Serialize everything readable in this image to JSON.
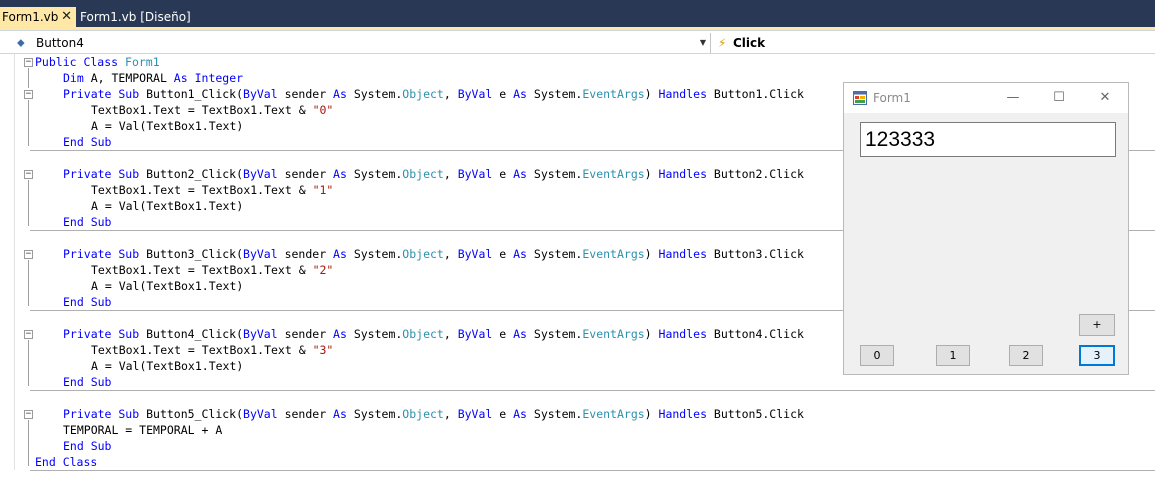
{
  "tabs": [
    {
      "label": "Form1.vb",
      "close": "✕"
    },
    {
      "label": "Form1.vb [Diseño]"
    }
  ],
  "navbar": {
    "object": "Button4",
    "event": "Click"
  },
  "code": {
    "l1": [
      "Public Class ",
      "Form1"
    ],
    "l2": [
      "Dim",
      " A, TEMPORAL ",
      "As",
      " ",
      "Integer"
    ],
    "b1": [
      "Private Sub",
      " Button1_Click(",
      "ByVal",
      " sender ",
      "As",
      " System.",
      "Object",
      ", ",
      "ByVal",
      " e ",
      "As",
      " System.",
      "EventArgs",
      ") ",
      "Handles",
      " Button1.Click"
    ],
    "b1a": [
      "TextBox1.Text = TextBox1.Text & ",
      "\"0\""
    ],
    "b2": [
      "Private Sub",
      " Button2_Click(",
      "ByVal",
      " sender ",
      "As",
      " System.",
      "Object",
      ", ",
      "ByVal",
      " e ",
      "As",
      " System.",
      "EventArgs",
      ") ",
      "Handles",
      " Button2.Click"
    ],
    "b2a": [
      "TextBox1.Text = TextBox1.Text & ",
      "\"1\""
    ],
    "b3": [
      "Private Sub",
      " Button3_Click(",
      "ByVal",
      " sender ",
      "As",
      " System.",
      "Object",
      ", ",
      "ByVal",
      " e ",
      "As",
      " System.",
      "EventArgs",
      ") ",
      "Handles",
      " Button3.Click"
    ],
    "b3a": [
      "TextBox1.Text = TextBox1.Text & ",
      "\"2\""
    ],
    "b4": [
      "Private Sub",
      " Button4_Click(",
      "ByVal",
      " sender ",
      "As",
      " System.",
      "Object",
      ", ",
      "ByVal",
      " e ",
      "As",
      " System.",
      "EventArgs",
      ") ",
      "Handles",
      " Button4.Click"
    ],
    "b4a": [
      "TextBox1.Text = TextBox1.Text & ",
      "\"3\""
    ],
    "b5": [
      "Private Sub",
      " Button5_Click(",
      "ByVal",
      " sender ",
      "As",
      " System.",
      "Object",
      ", ",
      "ByVal",
      " e ",
      "As",
      " System.",
      "EventArgs",
      ") ",
      "Handles",
      " Button5.Click"
    ],
    "val": "A = Val(TextBox1.Text)",
    "temporal": "TEMPORAL = TEMPORAL + A",
    "endsub": "End Sub",
    "endclass": "End Class"
  },
  "form": {
    "title": "Form1",
    "minimize": "—",
    "maximize": "☐",
    "close": "✕",
    "textbox": "123333",
    "buttons": [
      "0",
      "1",
      "2",
      "3"
    ],
    "plus": "+"
  }
}
